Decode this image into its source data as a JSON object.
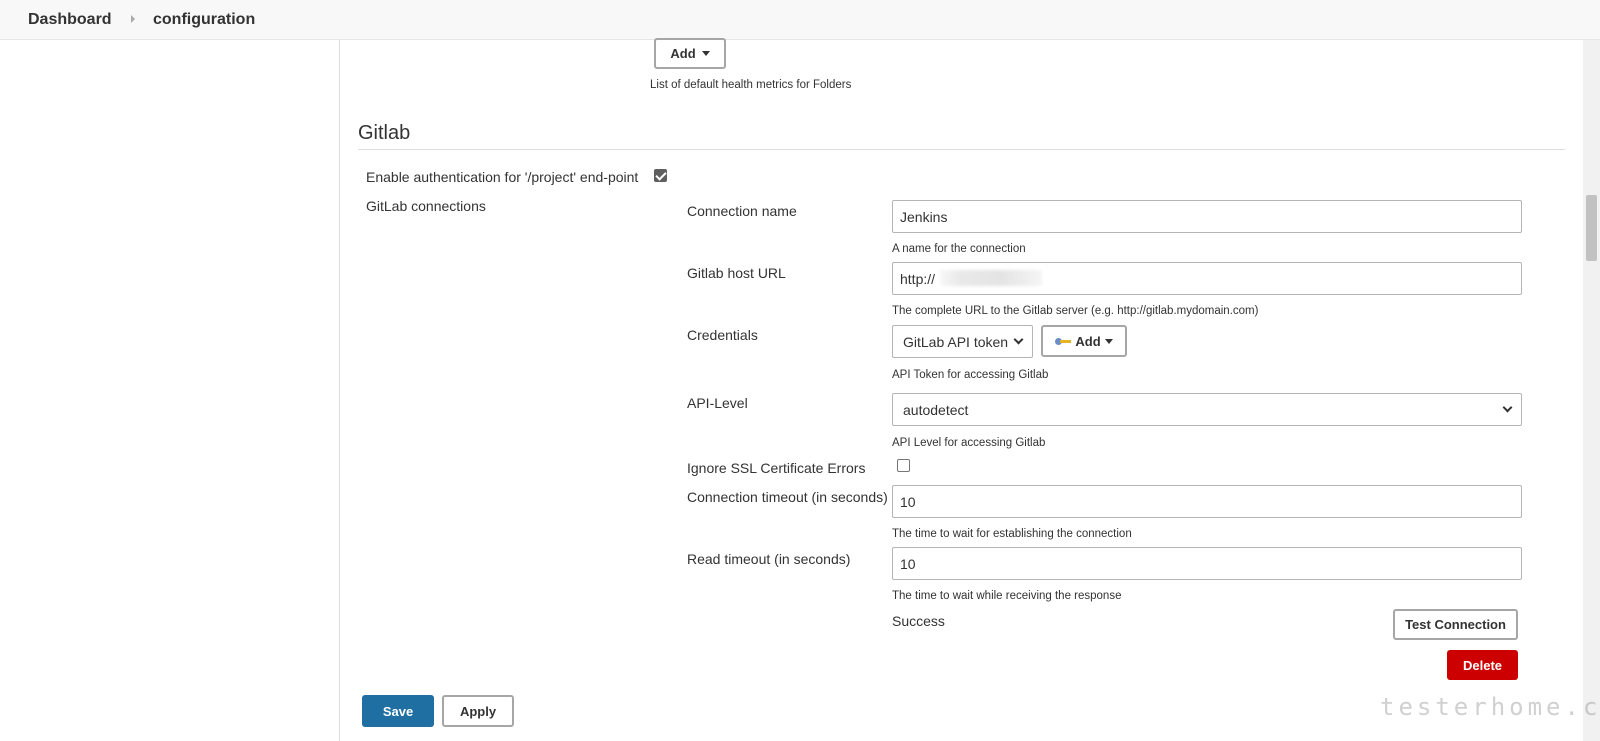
{
  "breadcrumb": {
    "items": [
      "Dashboard",
      "configuration"
    ]
  },
  "folders": {
    "add_button": "Add",
    "help": "List of default health metrics for Folders"
  },
  "gitlab": {
    "section_title": "Gitlab",
    "enable_auth_label": "Enable authentication for '/project' end-point",
    "enable_auth_checked": true,
    "connections_label": "GitLab connections",
    "connection_name": {
      "label": "Connection name",
      "value": "Jenkins",
      "help": "A name for the connection"
    },
    "host_url": {
      "label": "Gitlab host URL",
      "value": "http://",
      "help": "The complete URL to the Gitlab server (e.g. http://gitlab.mydomain.com)"
    },
    "credentials": {
      "label": "Credentials",
      "selected": "GitLab API token",
      "add_button": "Add",
      "help": "API Token for accessing Gitlab"
    },
    "api_level": {
      "label": "API-Level",
      "selected": "autodetect",
      "help": "API Level for accessing Gitlab"
    },
    "ignore_ssl": {
      "label": "Ignore SSL Certificate Errors",
      "checked": false
    },
    "connection_timeout": {
      "label": "Connection timeout (in seconds)",
      "value": "10",
      "help": "The time to wait for establishing the connection"
    },
    "read_timeout": {
      "label": "Read timeout (in seconds)",
      "value": "10",
      "help": "The time to wait while receiving the response"
    },
    "test_status": "Success",
    "test_button": "Test Connection",
    "delete_button": "Delete"
  },
  "footer": {
    "save_button": "Save",
    "apply_button": "Apply"
  },
  "watermark": "testerhome.com",
  "colors": {
    "primary": "#1f6fa3",
    "danger": "#cc0000"
  }
}
